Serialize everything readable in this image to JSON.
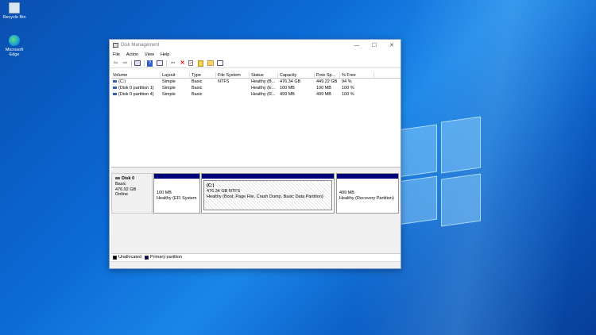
{
  "desktop": {
    "icons": [
      {
        "label": "Recycle Bin"
      },
      {
        "label": "Microsoft Edge"
      }
    ]
  },
  "window": {
    "title": "Disk Management",
    "controls": {
      "minimize": "—",
      "maximize": "☐",
      "close": "✕"
    }
  },
  "menu": [
    "File",
    "Action",
    "View",
    "Help"
  ],
  "columns": [
    "Volume",
    "Layout",
    "Type",
    "File System",
    "Status",
    "Capacity",
    "Free Sp...",
    "% Free"
  ],
  "volumes": [
    {
      "volume": "(C:)",
      "layout": "Simple",
      "type": "Basic",
      "fs": "NTFS",
      "status": "Healthy (B...",
      "capacity": "476.34 GB",
      "free": "449.22 GB",
      "pct": "94 %"
    },
    {
      "volume": "(Disk 0 partition 1)",
      "layout": "Simple",
      "type": "Basic",
      "fs": "",
      "status": "Healthy (E...",
      "capacity": "100 MB",
      "free": "100 MB",
      "pct": "100 %"
    },
    {
      "volume": "(Disk 0 partition 4)",
      "layout": "Simple",
      "type": "Basic",
      "fs": "",
      "status": "Healthy (R...",
      "capacity": "499 MB",
      "free": "499 MB",
      "pct": "100 %"
    }
  ],
  "disk": {
    "name": "Disk 0",
    "type": "Basic",
    "size": "476.92 GB",
    "state": "Online",
    "partitions": [
      {
        "title": "",
        "size": "100 MB",
        "status": "Healthy (EFI System"
      },
      {
        "title": "(C:)",
        "size": "476.34 GB NTFS",
        "status": "Healthy (Boot, Page File, Crash Dump, Basic Data Partition)"
      },
      {
        "title": "",
        "size": "499 MB",
        "status": "Healthy (Recovery Partition)"
      }
    ]
  },
  "legend": {
    "unallocated": "Unallocated",
    "primary": "Primary partition",
    "unallocated_color": "#000000",
    "primary_color": "#00007a"
  }
}
